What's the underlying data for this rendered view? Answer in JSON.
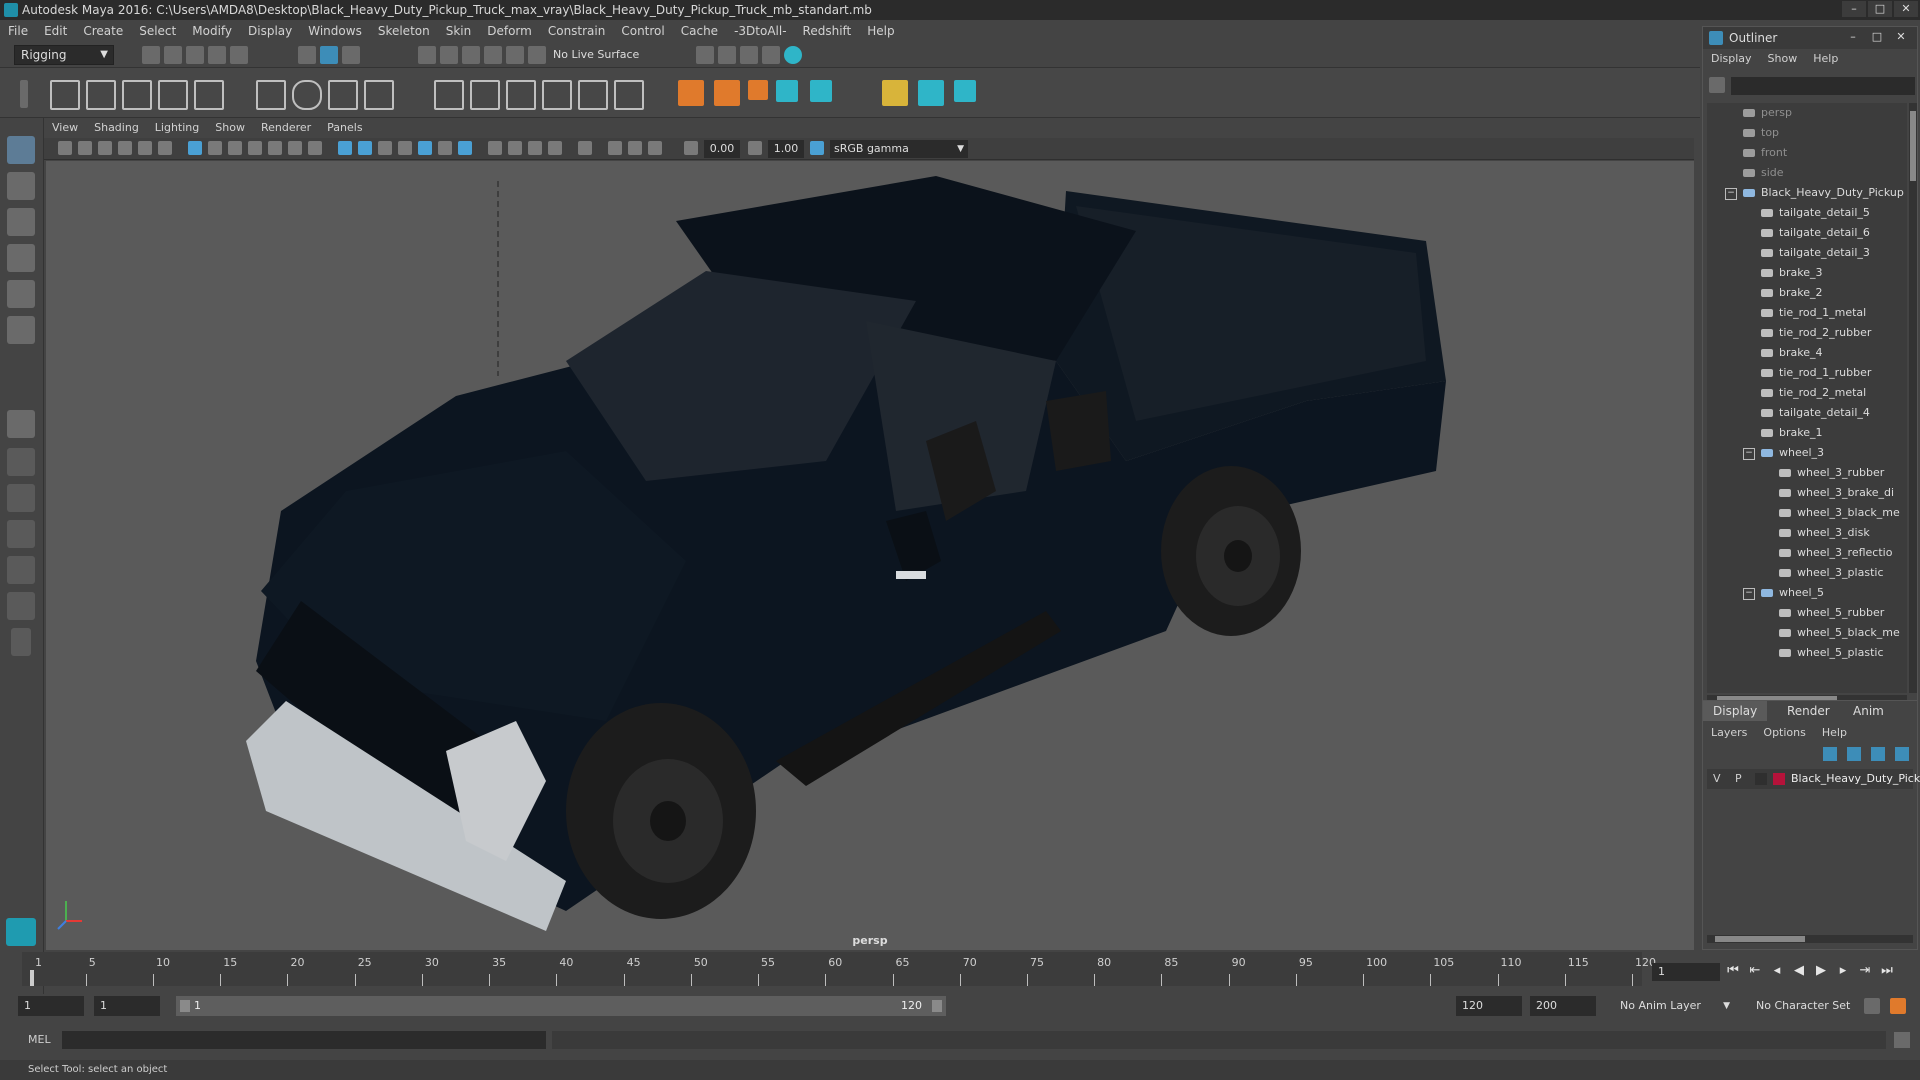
{
  "window": {
    "title": "Autodesk Maya 2016: C:\\Users\\AMDA8\\Desktop\\Black_Heavy_Duty_Pickup_Truck_max_vray\\Black_Heavy_Duty_Pickup_Truck_mb_standart.mb"
  },
  "menubar": [
    "File",
    "Edit",
    "Create",
    "Select",
    "Modify",
    "Display",
    "Windows",
    "Skeleton",
    "Skin",
    "Deform",
    "Constrain",
    "Control",
    "Cache",
    "-3DtoAll-",
    "Redshift",
    "Help"
  ],
  "statusline": {
    "mode": "Rigging",
    "live_surface": "No Live Surface"
  },
  "panel": {
    "menu": [
      "View",
      "Shading",
      "Lighting",
      "Show",
      "Renderer",
      "Panels"
    ],
    "exposure": "0.00",
    "gamma": "1.00",
    "color_space": "sRGB gamma",
    "camera": "persp"
  },
  "timeline": {
    "ticks": [
      1,
      5,
      10,
      15,
      20,
      25,
      30,
      35,
      40,
      45,
      50,
      55,
      60,
      65,
      70,
      75,
      80,
      85,
      90,
      95,
      100,
      105,
      110,
      115,
      120
    ],
    "current_frame": "1"
  },
  "range": {
    "start": "1",
    "playback_start": "1",
    "slider_start": "1",
    "slider_end": "120",
    "playback_end": "120",
    "end": "200",
    "anim_layer": "No Anim Layer",
    "character_set": "No Character Set"
  },
  "cmdline": {
    "label": "MEL"
  },
  "helpline": {
    "text": "Select Tool: select an object"
  },
  "outliner": {
    "title": "Outliner",
    "menu": [
      "Display",
      "Show",
      "Help"
    ],
    "items": [
      {
        "label": "persp",
        "level": 0,
        "dim": true,
        "type": "cam"
      },
      {
        "label": "top",
        "level": 0,
        "dim": true,
        "type": "cam"
      },
      {
        "label": "front",
        "level": 0,
        "dim": true,
        "type": "cam"
      },
      {
        "label": "side",
        "level": 0,
        "dim": true,
        "type": "cam"
      },
      {
        "label": "Black_Heavy_Duty_Pickup",
        "level": 0,
        "dim": false,
        "type": "group",
        "expanded": true
      },
      {
        "label": "tailgate_detail_5",
        "level": 1,
        "type": "mesh"
      },
      {
        "label": "tailgate_detail_6",
        "level": 1,
        "type": "mesh"
      },
      {
        "label": "tailgate_detail_3",
        "level": 1,
        "type": "mesh"
      },
      {
        "label": "brake_3",
        "level": 1,
        "type": "mesh"
      },
      {
        "label": "brake_2",
        "level": 1,
        "type": "mesh"
      },
      {
        "label": "tie_rod_1_metal",
        "level": 1,
        "type": "mesh"
      },
      {
        "label": "tie_rod_2_rubber",
        "level": 1,
        "type": "mesh"
      },
      {
        "label": "brake_4",
        "level": 1,
        "type": "mesh"
      },
      {
        "label": "tie_rod_1_rubber",
        "level": 1,
        "type": "mesh"
      },
      {
        "label": "tie_rod_2_metal",
        "level": 1,
        "type": "mesh"
      },
      {
        "label": "tailgate_detail_4",
        "level": 1,
        "type": "mesh"
      },
      {
        "label": "brake_1",
        "level": 1,
        "type": "mesh"
      },
      {
        "label": "wheel_3",
        "level": 1,
        "type": "group",
        "expanded": true
      },
      {
        "label": "wheel_3_rubber",
        "level": 2,
        "type": "mesh"
      },
      {
        "label": "wheel_3_brake_di",
        "level": 2,
        "type": "mesh"
      },
      {
        "label": "wheel_3_black_me",
        "level": 2,
        "type": "mesh"
      },
      {
        "label": "wheel_3_disk",
        "level": 2,
        "type": "mesh"
      },
      {
        "label": "wheel_3_reflectio",
        "level": 2,
        "type": "mesh"
      },
      {
        "label": "wheel_3_plastic",
        "level": 2,
        "type": "mesh"
      },
      {
        "label": "wheel_5",
        "level": 1,
        "type": "group",
        "expanded": true
      },
      {
        "label": "wheel_5_rubber",
        "level": 2,
        "type": "mesh"
      },
      {
        "label": "wheel_5_black_me",
        "level": 2,
        "type": "mesh"
      },
      {
        "label": "wheel_5_plastic",
        "level": 2,
        "type": "mesh"
      }
    ]
  },
  "channel": {
    "tabs": [
      "Display",
      "Render",
      "Anim"
    ],
    "menu": [
      "Layers",
      "Options",
      "Help"
    ],
    "layer": {
      "v": "V",
      "p": "P",
      "name": "Black_Heavy_Duty_Pick",
      "color": "#b5123a"
    }
  },
  "colors": {
    "accent": "#3d8db8",
    "truck": "#0c1520"
  }
}
